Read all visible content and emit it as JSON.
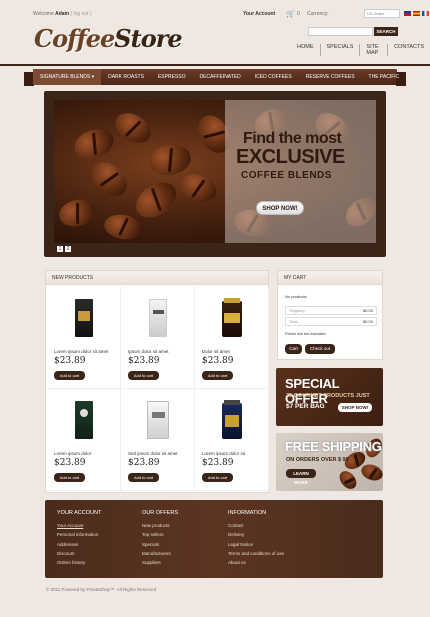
{
  "topbar": {
    "welcome": "Welcome",
    "user": "Adam",
    "logout": "( log out )",
    "account": "Your Account",
    "cart_count": "0",
    "currency_label": "Currency:",
    "select_value": "US Dollar"
  },
  "logo": {
    "part1": "Coffee",
    "part2": "Store"
  },
  "search": {
    "button": "SEARCH"
  },
  "toplinks": [
    "HOME",
    "SPECIALS",
    "SITE MAP",
    "CONTACTS"
  ],
  "nav": {
    "items": [
      "SIGNATURE BLENDS",
      "DARK ROASTS",
      "ESPRESSO",
      "DECAFFEINATED",
      "ICED COFFEES",
      "RESERVE COFFEES",
      "THE PACIFIC"
    ]
  },
  "slider": {
    "line1": "Find the most",
    "line2": "EXCLUSIVE",
    "line3": "COFFEE BLENDS",
    "button": "SHOP NOW!",
    "pages": [
      "1",
      "2"
    ]
  },
  "products": {
    "title": "NEW PRODUCTS",
    "add_label": "Add to cart",
    "items": [
      {
        "name": "Lorem ipsum dolor sit amet",
        "price": "$23.89"
      },
      {
        "name": "Ipsum dolor sit amet",
        "price": "$23.89"
      },
      {
        "name": "Dolor sit amet",
        "price": "$23.89"
      },
      {
        "name": "Lorem ipsum dolor",
        "price": "$23.89"
      },
      {
        "name": "Sed ipsum dolor sit amet",
        "price": "$23.89"
      },
      {
        "name": "Lorem ipsum dolor sit",
        "price": "$23.89"
      }
    ]
  },
  "cart": {
    "title": "MY CART",
    "empty": "No products",
    "shipping_label": "Shipping",
    "shipping_value": "$0.00",
    "total_label": "Total",
    "total_value": "$0.00",
    "tax_note": "Prices are tax included",
    "cart_btn": "Cart",
    "checkout_btn": "Check out"
  },
  "promo1": {
    "title": "SPECIAL OFFER",
    "sub1": "25 GOURMET PRODUCTS JUST",
    "price": "$7 PER BAG",
    "button": "SHOP NOW!"
  },
  "promo2": {
    "title": "FREE SHIPPING",
    "sub": "ON ORDERS OVER $ 99",
    "button": "LEARN MORE"
  },
  "footer": {
    "cols": [
      {
        "title": "YOUR ACCOUNT",
        "links": [
          "Your Account",
          "Personal information",
          "Addresses",
          "Discount",
          "Orders history"
        ]
      },
      {
        "title": "OUR OFFERS",
        "links": [
          "New products",
          "Top sellers",
          "Specials",
          "Manufacturers",
          "Suppliers"
        ]
      },
      {
        "title": "INFORMATION",
        "links": [
          "Contact",
          "Delivery",
          "Legal Notice",
          "Terms and conditions of use",
          "About us"
        ]
      }
    ],
    "copyright": "© 2011 Powered by PrestaShop™. All Rights Reserved"
  }
}
